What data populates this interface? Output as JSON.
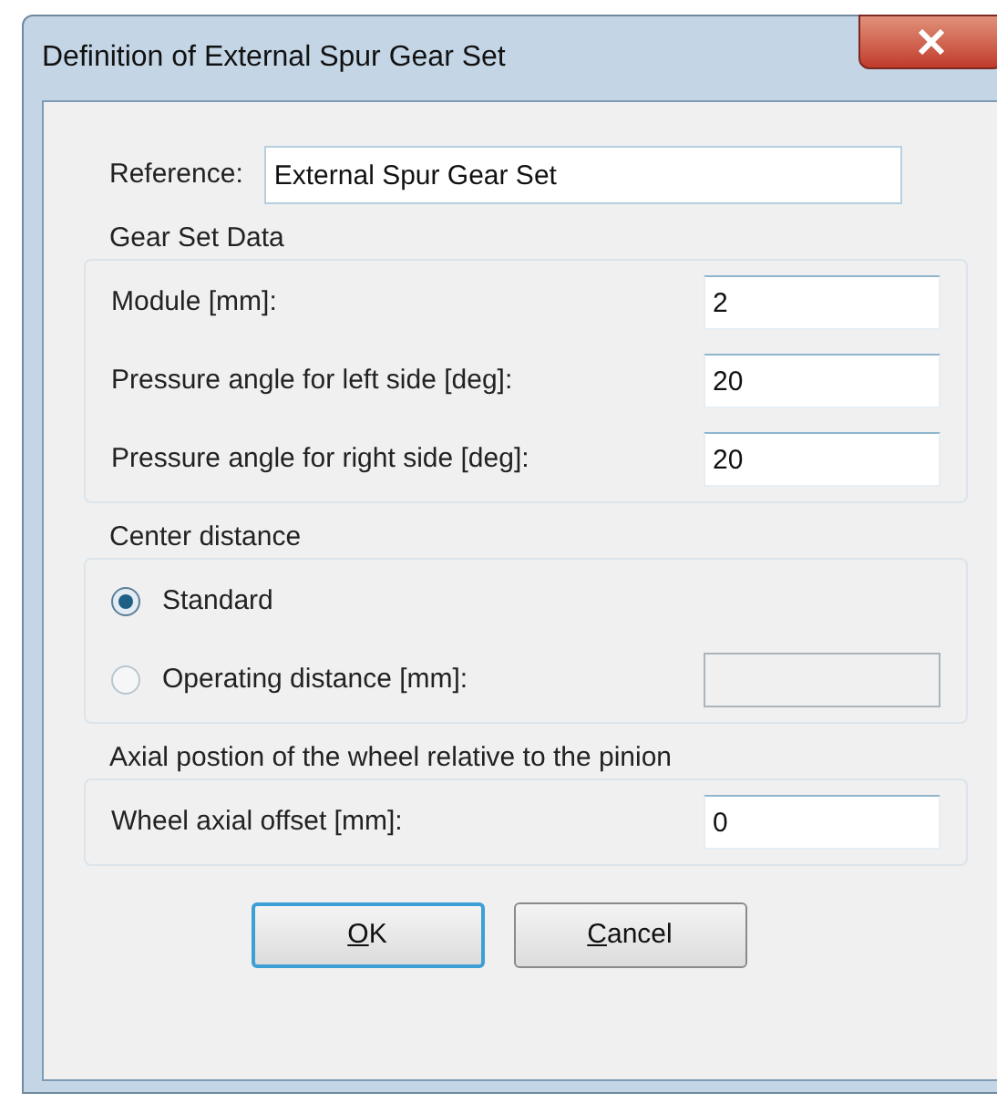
{
  "window": {
    "title": "Definition of External Spur Gear Set"
  },
  "reference": {
    "label": "Reference:",
    "value": "External Spur Gear Set"
  },
  "gear_set_data": {
    "title": "Gear Set Data",
    "fields": [
      {
        "label": "Module [mm]:",
        "value": "2",
        "disabled": false
      },
      {
        "label": "Pressure angle for left side [deg]:",
        "value": "20",
        "disabled": false
      },
      {
        "label": "Pressure angle for right side [deg]:",
        "value": "20",
        "disabled": false
      }
    ]
  },
  "center_distance": {
    "title": "Center distance",
    "options": [
      {
        "label": "Standard",
        "selected": true
      },
      {
        "label": "Operating distance [mm]:",
        "selected": false,
        "field": {
          "disabled": true
        }
      }
    ]
  },
  "axial_position": {
    "title": "Axial postion of the wheel relative to the pinion",
    "fields": [
      {
        "label": "Wheel axial offset [mm]:",
        "value": "0",
        "disabled": false
      }
    ]
  },
  "buttons": [
    {
      "label": "OK",
      "default": true
    },
    {
      "label": "Cancel",
      "default": false
    }
  ]
}
